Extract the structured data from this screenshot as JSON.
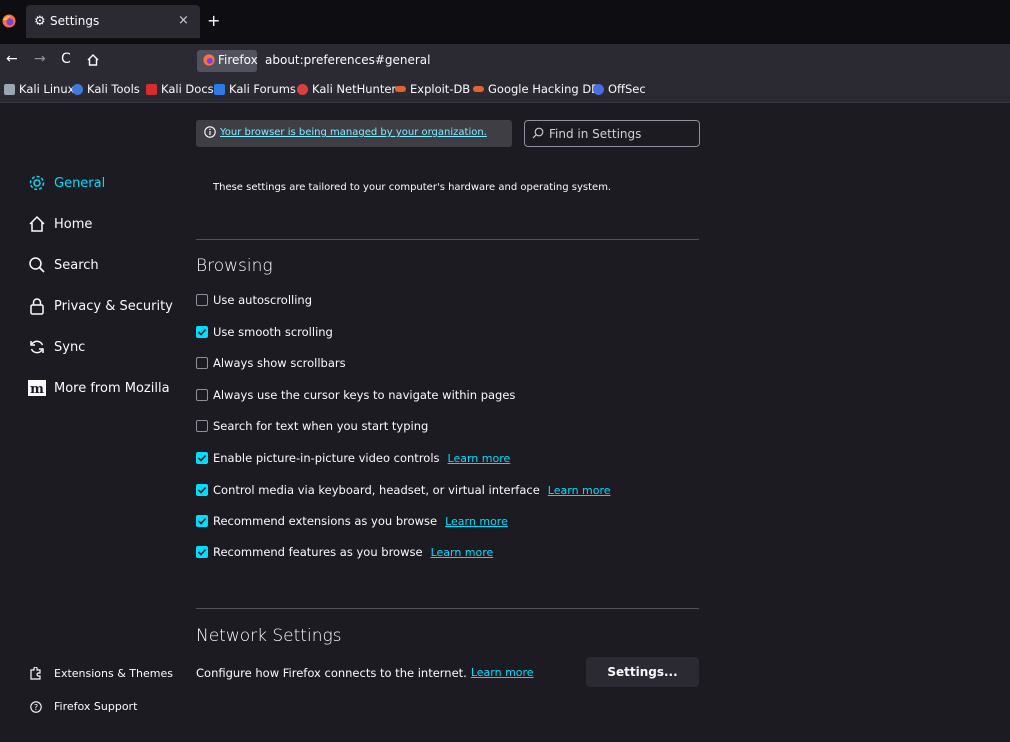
{
  "tab": {
    "title": "Settings",
    "close": "×",
    "new_tab": "+"
  },
  "nav": {
    "back": "←",
    "forward": "→",
    "reload": "C",
    "identity_label": "Firefox",
    "url": "about:preferences#general"
  },
  "bookmarks": [
    {
      "label": "Kali Linux",
      "icon": "kali-dragon-icon",
      "color": "#9aa6b2"
    },
    {
      "label": "Kali Tools",
      "icon": "kali-tools-icon",
      "color": "#3d7be0"
    },
    {
      "label": "Kali Docs",
      "icon": "kali-docs-icon",
      "color": "#d92c2c"
    },
    {
      "label": "Kali Forums",
      "icon": "kali-forums-icon",
      "color": "#2f7ae5"
    },
    {
      "label": "Kali NetHunter",
      "icon": "nethunter-icon",
      "color": "#d94040"
    },
    {
      "label": "Exploit-DB",
      "icon": "exploit-db-icon",
      "color": "#e5642e"
    },
    {
      "label": "Google Hacking DB",
      "icon": "ghdb-icon",
      "color": "#e5642e"
    },
    {
      "label": "OffSec",
      "icon": "offsec-icon",
      "color": "#4a6ee0"
    }
  ],
  "sidebar": {
    "items": [
      {
        "label": "General",
        "icon": "gear-icon",
        "active": true
      },
      {
        "label": "Home",
        "icon": "home-icon"
      },
      {
        "label": "Search",
        "icon": "search-icon"
      },
      {
        "label": "Privacy & Security",
        "icon": "lock-icon"
      },
      {
        "label": "Sync",
        "icon": "sync-icon"
      },
      {
        "label": "More from Mozilla",
        "icon": "mozilla-m-icon"
      }
    ],
    "footer": [
      {
        "label": "Extensions & Themes",
        "icon": "puzzle-icon"
      },
      {
        "label": "Firefox Support",
        "icon": "help-icon"
      }
    ]
  },
  "policy_notice": "Your browser is being managed by your organization.",
  "search": {
    "placeholder": "Find in Settings"
  },
  "tailored_text": "These settings are tailored to your computer's hardware and operating system.",
  "browsing": {
    "title": "Browsing",
    "options": [
      {
        "label": "Use autoscrolling",
        "checked": false
      },
      {
        "label": "Use smooth scrolling",
        "checked": true
      },
      {
        "label": "Always show scrollbars",
        "checked": false
      },
      {
        "label": "Always use the cursor keys to navigate within pages",
        "checked": false
      },
      {
        "label": "Search for text when you start typing",
        "checked": false
      },
      {
        "label": "Enable picture-in-picture video controls",
        "checked": true,
        "learn_more": "Learn more"
      },
      {
        "label": "Control media via keyboard, headset, or virtual interface",
        "checked": true,
        "learn_more": "Learn more"
      },
      {
        "label": "Recommend extensions as you browse",
        "checked": true,
        "learn_more": "Learn more"
      },
      {
        "label": "Recommend features as you browse",
        "checked": true,
        "learn_more": "Learn more"
      }
    ]
  },
  "network": {
    "title": "Network Settings",
    "description": "Configure how Firefox connects to the internet.",
    "learn_more": "Learn more",
    "button": "Settings..."
  }
}
